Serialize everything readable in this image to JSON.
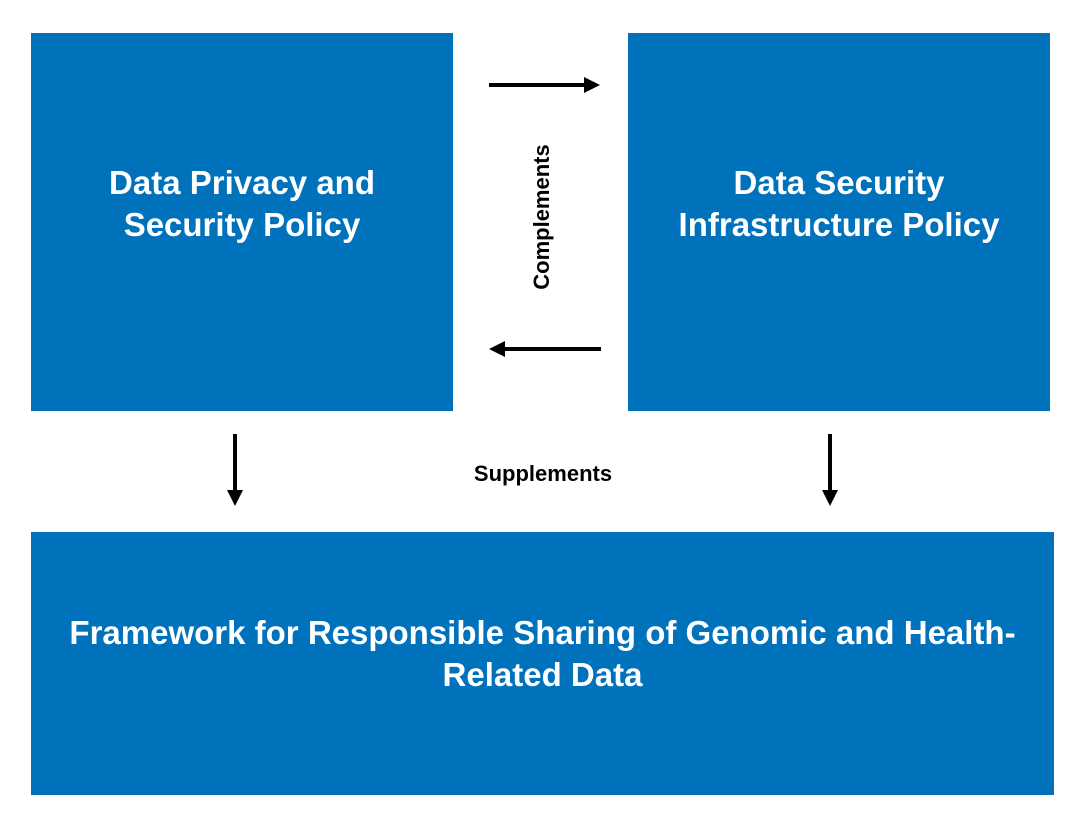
{
  "boxes": {
    "privacy_policy": "Data Privacy and Security Policy",
    "infrastructure_policy": "Data Security Infrastructure Policy",
    "framework": "Framework for Responsible Sharing of Genomic and Health-Related Data"
  },
  "relations": {
    "complements": "Complements",
    "supplements": "Supplements"
  },
  "colors": {
    "box_fill": "#0072bb",
    "box_text": "#ffffff",
    "arrow": "#000000"
  }
}
